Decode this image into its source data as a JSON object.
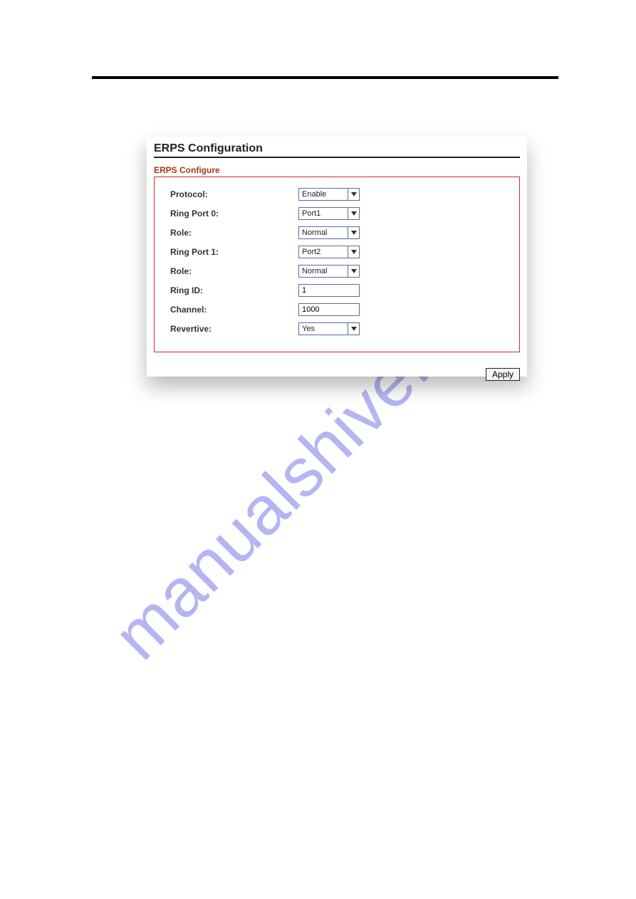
{
  "watermark": "manualshive.com",
  "screenshot": {
    "title": "ERPS Configuration",
    "subtitle": "ERPS Configure",
    "fields": {
      "protocol": {
        "label": "Protocol:",
        "value": "Enable",
        "type": "select"
      },
      "ring_port_0": {
        "label": "Ring Port 0:",
        "value": "Port1",
        "type": "select"
      },
      "role_0": {
        "label": "Role:",
        "value": "Normal",
        "type": "select"
      },
      "ring_port_1": {
        "label": "Ring Port 1:",
        "value": "Port2",
        "type": "select"
      },
      "role_1": {
        "label": "Role:",
        "value": "Normal",
        "type": "select"
      },
      "ring_id": {
        "label": "Ring ID:",
        "value": "1",
        "type": "text"
      },
      "channel": {
        "label": "Channel:",
        "value": "1000",
        "type": "text"
      },
      "revertive": {
        "label": "Revertive:",
        "value": "Yes",
        "type": "select"
      }
    },
    "apply_label": "Apply"
  }
}
